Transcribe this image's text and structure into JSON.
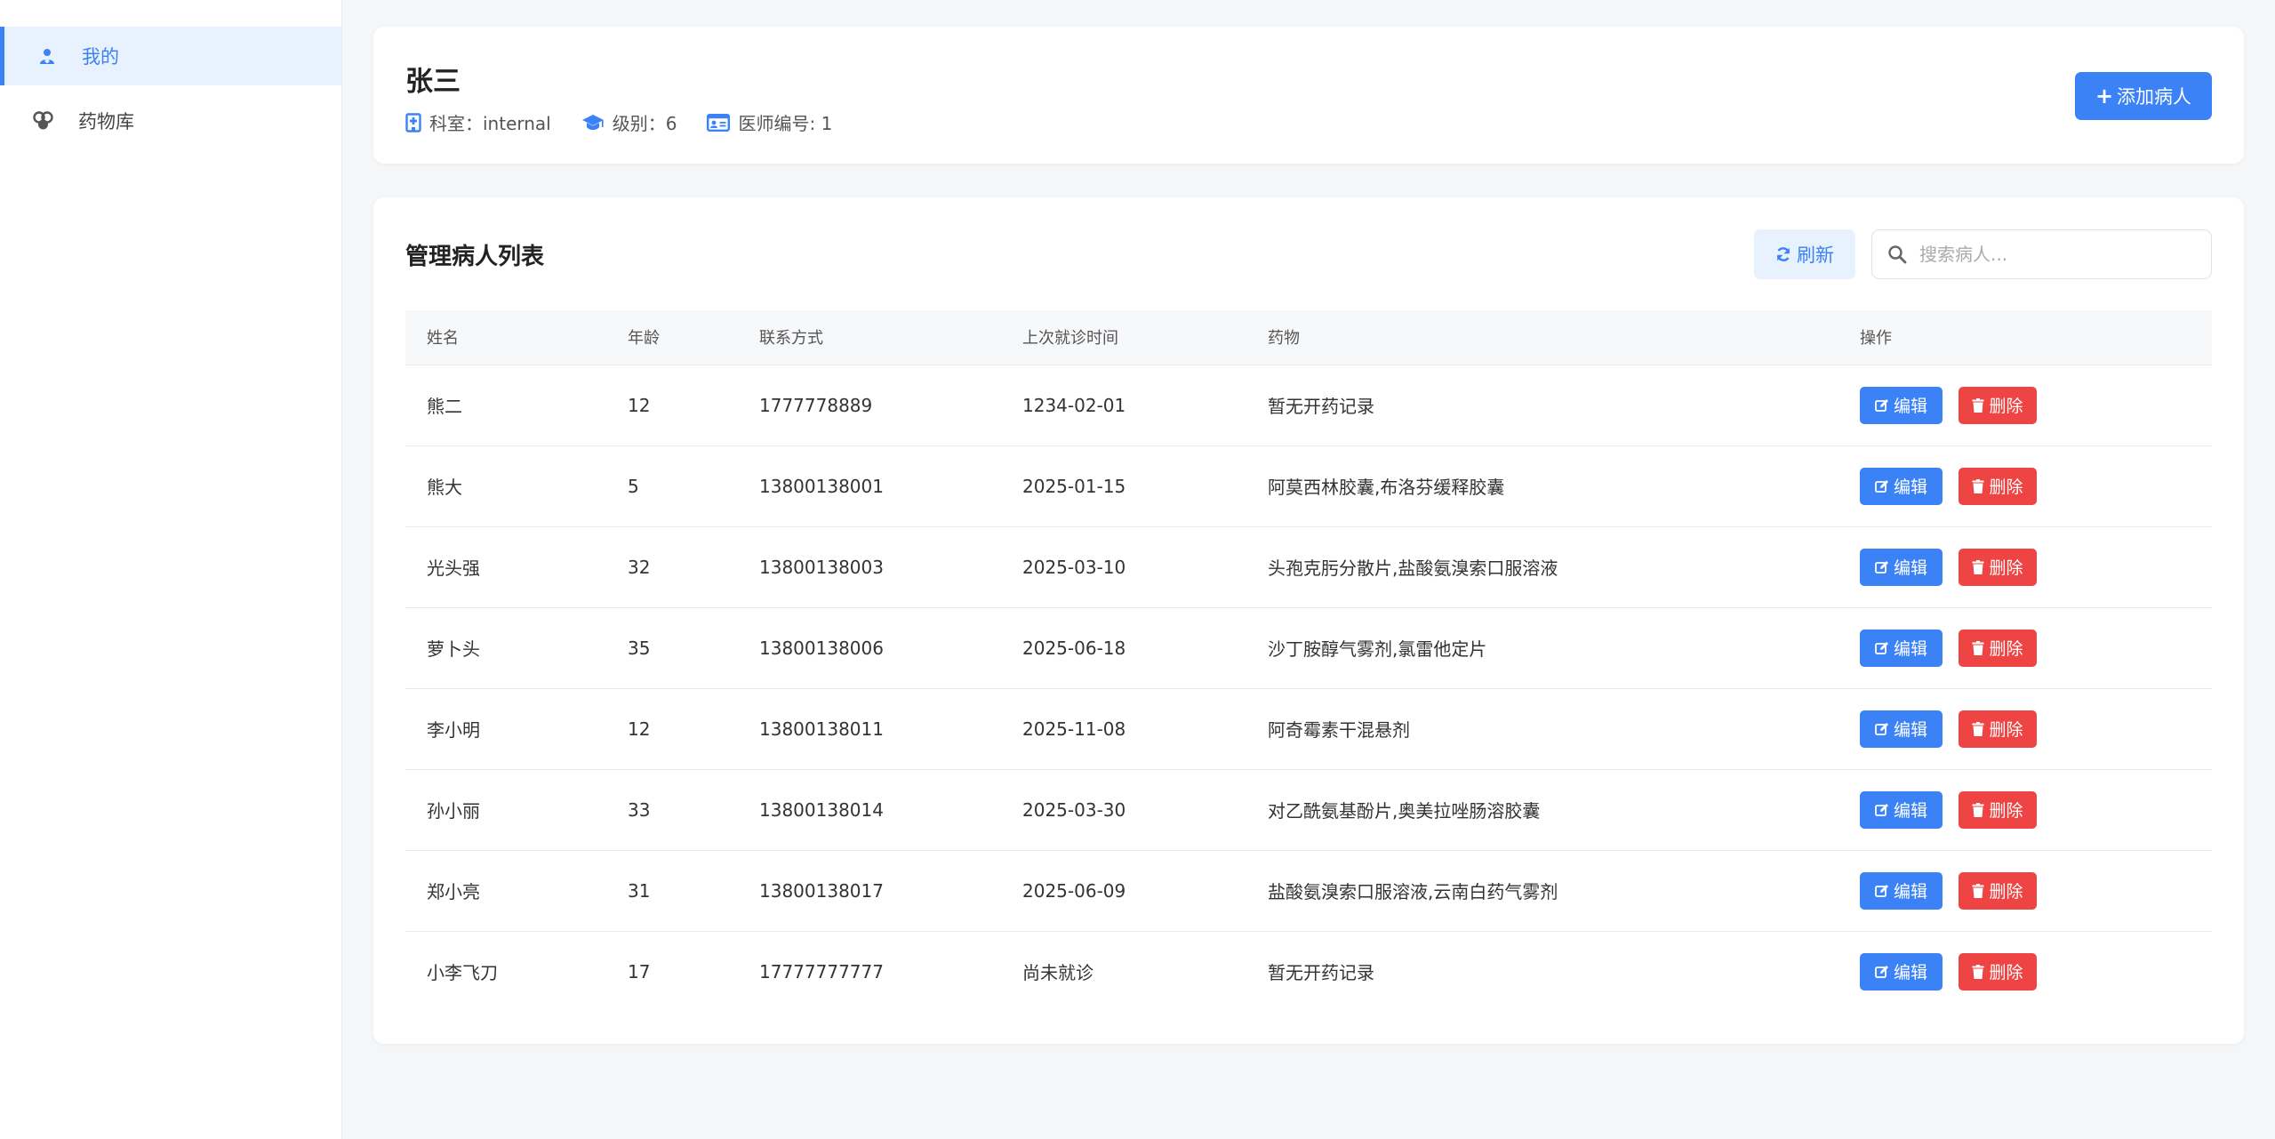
{
  "sidebar": {
    "items": [
      {
        "label": "我的",
        "icon": "user-doctor-icon",
        "active": true
      },
      {
        "label": "药物库",
        "icon": "pills-icon",
        "active": false
      }
    ]
  },
  "profile": {
    "name": "张三",
    "department_label": "科室：internal",
    "level_label": "级别：6",
    "doctor_id_label": "医师编号: 1",
    "add_patient_label": "添加病人"
  },
  "patients": {
    "title": "管理病人列表",
    "refresh_label": "刷新",
    "search_placeholder": "搜索病人...",
    "columns": [
      "姓名",
      "年龄",
      "联系方式",
      "上次就诊时间",
      "药物",
      "操作"
    ],
    "edit_label": "编辑",
    "delete_label": "删除",
    "rows": [
      {
        "name": "熊二",
        "age": "12",
        "contact": "1777778889",
        "last_visit": "1234-02-01",
        "meds": "暂无开药记录"
      },
      {
        "name": "熊大",
        "age": "5",
        "contact": "13800138001",
        "last_visit": "2025-01-15",
        "meds": "阿莫西林胶囊,布洛芬缓释胶囊"
      },
      {
        "name": "光头强",
        "age": "32",
        "contact": "13800138003",
        "last_visit": "2025-03-10",
        "meds": "头孢克肟分散片,盐酸氨溴索口服溶液"
      },
      {
        "name": "萝卜头",
        "age": "35",
        "contact": "13800138006",
        "last_visit": "2025-06-18",
        "meds": "沙丁胺醇气雾剂,氯雷他定片"
      },
      {
        "name": "李小明",
        "age": "12",
        "contact": "13800138011",
        "last_visit": "2025-11-08",
        "meds": "阿奇霉素干混悬剂"
      },
      {
        "name": "孙小丽",
        "age": "33",
        "contact": "13800138014",
        "last_visit": "2025-03-30",
        "meds": "对乙酰氨基酚片,奥美拉唑肠溶胶囊"
      },
      {
        "name": "郑小亮",
        "age": "31",
        "contact": "13800138017",
        "last_visit": "2025-06-09",
        "meds": "盐酸氨溴索口服溶液,云南白药气雾剂"
      },
      {
        "name": "小李飞刀",
        "age": "17",
        "contact": "17777777777",
        "last_visit": "尚未就诊",
        "meds": "暂无开药记录"
      }
    ]
  },
  "colors": {
    "primary": "#3b82f6",
    "danger": "#ef4444",
    "active_bg": "#e8f1fe"
  }
}
